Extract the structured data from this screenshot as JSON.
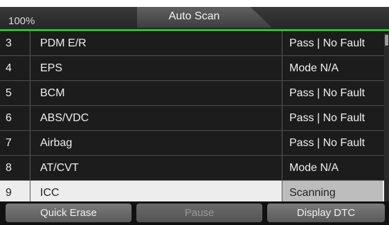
{
  "header": {
    "battery": "100%",
    "title": "Auto Scan"
  },
  "rows": [
    {
      "num": "3",
      "name": "PDM E/R",
      "status": "Pass | No Fault"
    },
    {
      "num": "4",
      "name": "EPS",
      "status": "Mode N/A"
    },
    {
      "num": "5",
      "name": "BCM",
      "status": "Pass | No Fault"
    },
    {
      "num": "6",
      "name": "ABS/VDC",
      "status": "Pass | No Fault"
    },
    {
      "num": "7",
      "name": "Airbag",
      "status": "Pass | No Fault"
    },
    {
      "num": "8",
      "name": "AT/CVT",
      "status": "Mode N/A"
    },
    {
      "num": "9",
      "name": "ICC",
      "status": "Scanning"
    }
  ],
  "buttons": {
    "quick_erase": "Quick Erase",
    "pause": "Pause",
    "display_dtc": "Display DTC"
  },
  "colors": {
    "accent_line": "#2bbf35",
    "background": "#1c1c1c",
    "selected_row": "#ededed"
  }
}
